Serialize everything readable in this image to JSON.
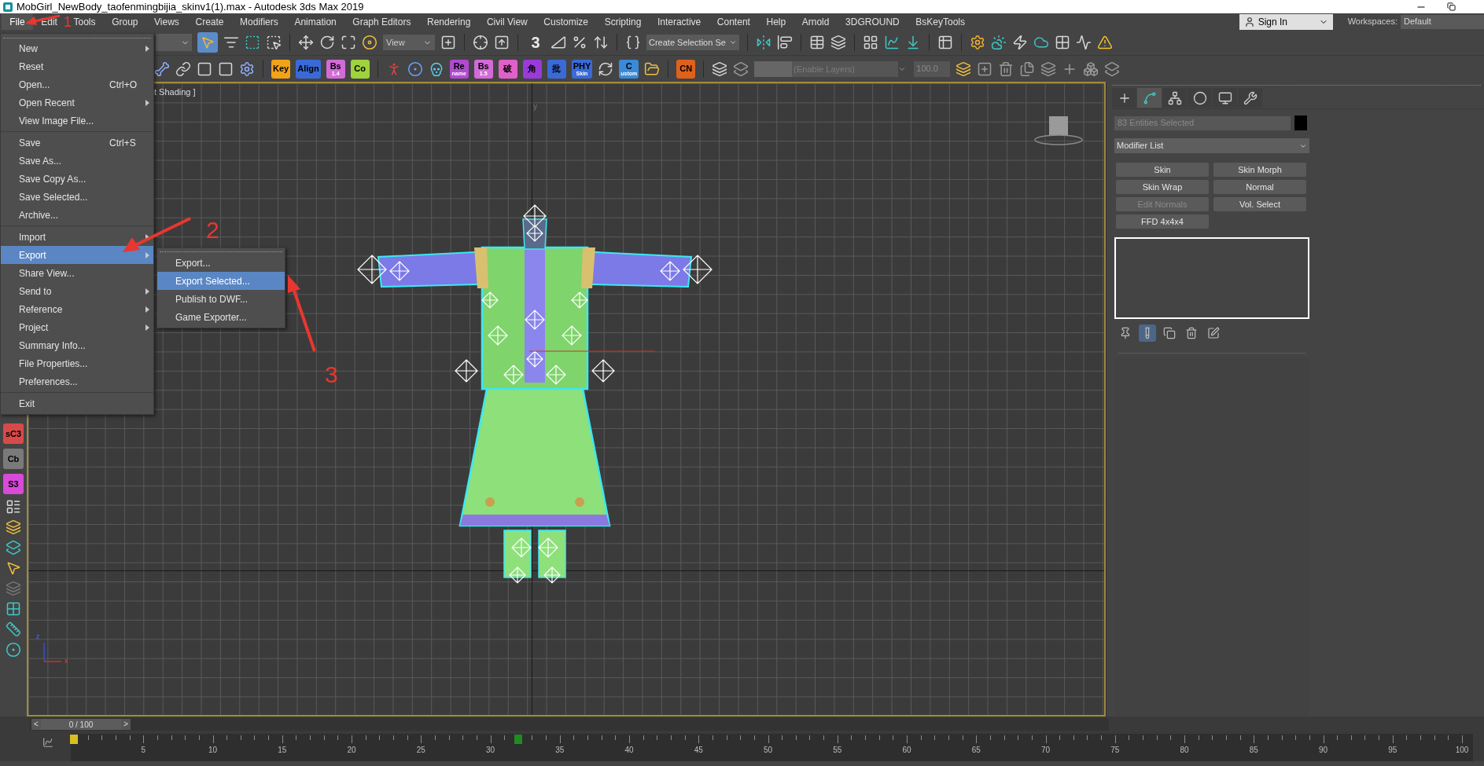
{
  "window": {
    "title": "MobGirl_NewBody_taofenmingbijia_skinv1(1).max - Autodesk 3ds Max 2019"
  },
  "menu_bar": {
    "items": [
      {
        "label": "File",
        "selected": true
      },
      {
        "label": "Edit",
        "selected": false
      },
      {
        "label": "Tools",
        "selected": false
      },
      {
        "label": "Group",
        "selected": false
      },
      {
        "label": "Views",
        "selected": false
      },
      {
        "label": "Create",
        "selected": false
      },
      {
        "label": "Modifiers",
        "selected": false
      },
      {
        "label": "Animation",
        "selected": false
      },
      {
        "label": "Graph Editors",
        "selected": false
      },
      {
        "label": "Rendering",
        "selected": false
      },
      {
        "label": "Civil View",
        "selected": false
      },
      {
        "label": "Customize",
        "selected": false
      },
      {
        "label": "Scripting",
        "selected": false
      },
      {
        "label": "Interactive",
        "selected": false
      },
      {
        "label": "Content",
        "selected": false
      },
      {
        "label": "Help",
        "selected": false
      },
      {
        "label": "Arnold",
        "selected": false
      },
      {
        "label": "3DGROUND",
        "selected": false
      },
      {
        "label": "BsKeyTools",
        "selected": false
      }
    ],
    "sign_in": "Sign In",
    "workspaces_label": "Workspaces:",
    "workspace": "Default"
  },
  "file_menu": {
    "groups": [
      [
        {
          "label": "New",
          "submenu": true,
          "selected": false
        },
        {
          "label": "Reset",
          "submenu": false,
          "selected": false
        },
        {
          "label": "Open...",
          "shortcut": "Ctrl+O",
          "submenu": false,
          "selected": false
        },
        {
          "label": "Open Recent",
          "submenu": true,
          "selected": false
        },
        {
          "label": "View Image File...",
          "submenu": false,
          "selected": false
        }
      ],
      [
        {
          "label": "Save",
          "shortcut": "Ctrl+S",
          "submenu": false,
          "selected": false
        },
        {
          "label": "Save As...",
          "submenu": false,
          "selected": false
        },
        {
          "label": "Save Copy As...",
          "submenu": false,
          "selected": false
        },
        {
          "label": "Save Selected...",
          "submenu": false,
          "selected": false
        },
        {
          "label": "Archive...",
          "submenu": false,
          "selected": false
        }
      ],
      [
        {
          "label": "Import",
          "submenu": true,
          "selected": false
        },
        {
          "label": "Export",
          "submenu": true,
          "selected": true
        },
        {
          "label": "Share View...",
          "submenu": false,
          "selected": false
        },
        {
          "label": "Send to",
          "submenu": true,
          "selected": false
        },
        {
          "label": "Reference",
          "submenu": true,
          "selected": false
        },
        {
          "label": "Project",
          "submenu": true,
          "selected": false
        },
        {
          "label": "Summary Info...",
          "submenu": false,
          "selected": false
        },
        {
          "label": "File Properties...",
          "submenu": false,
          "selected": false
        },
        {
          "label": "Preferences...",
          "submenu": false,
          "selected": false
        }
      ],
      [
        {
          "label": "Exit",
          "submenu": false,
          "selected": false
        }
      ]
    ]
  },
  "export_submenu": {
    "items": [
      {
        "label": "Export...",
        "selected": false
      },
      {
        "label": "Export Selected...",
        "selected": true
      },
      {
        "label": "Publish to DWF...",
        "selected": false
      },
      {
        "label": "Game Exporter...",
        "selected": false
      }
    ]
  },
  "main_toolbar": {
    "view_dropdown": "View",
    "snap_label": "3",
    "named_selection": "Create Selection Se"
  },
  "script_toolbar": {
    "badges_a": [
      {
        "label": "Key",
        "color": "#f2a318"
      },
      {
        "label": "Align",
        "color": "#3a6ad8"
      },
      {
        "label": "Bs",
        "sub": "1.4",
        "color": "#d46ad8"
      },
      {
        "label": "Co",
        "color": "#9fd23c"
      }
    ],
    "badges_b": [
      {
        "label": "Re",
        "sub": "name",
        "color": "#b04ad0"
      },
      {
        "label": "Bs",
        "sub": "1.5",
        "color": "#d46ad8"
      },
      {
        "label": "破",
        "color": "#e060c8"
      },
      {
        "label": "角",
        "color": "#9a3ad8"
      },
      {
        "label": "批",
        "color": "#3a6ad8"
      },
      {
        "label": "PHY",
        "sub": "Skin",
        "color": "#3a6ad8"
      }
    ],
    "badges_c": [
      {
        "label": "C",
        "sub": "ustom",
        "color": "#3a8ad8"
      }
    ],
    "badges_d": [
      {
        "label": "CN",
        "color": "#e0601c"
      }
    ],
    "layer_field": {
      "placeholder": "(Enable Layers)"
    },
    "opacity": "100.0"
  },
  "left_toolbar": {
    "badges": [
      {
        "label": "sC3",
        "color": "#d84a4a"
      },
      {
        "label": "Cb",
        "color": "#7a7a7a"
      },
      {
        "label": "S3",
        "color": "#d84ad8"
      }
    ]
  },
  "viewport": {
    "label": "t Shading ]",
    "grid_axis_label": "y",
    "tripod_labels": [
      "z",
      "x"
    ]
  },
  "command_panel": {
    "tabs": [
      {
        "kind": "create",
        "selected": false
      },
      {
        "kind": "modify",
        "selected": true
      },
      {
        "kind": "hierarchy",
        "selected": false
      },
      {
        "kind": "motion",
        "selected": false
      },
      {
        "kind": "display",
        "selected": false
      },
      {
        "kind": "utilities",
        "selected": false
      }
    ],
    "selection_name": "83 Entities Selected",
    "modifier_list": "Modifier List",
    "modifier_buttons": [
      {
        "label": "Skin",
        "disabled": false
      },
      {
        "label": "Skin Morph",
        "disabled": false
      },
      {
        "label": "Skin Wrap",
        "disabled": false
      },
      {
        "label": "Normal",
        "disabled": false
      },
      {
        "label": "Edit Normals",
        "disabled": true
      },
      {
        "label": "Vol. Select",
        "disabled": false
      },
      {
        "label": "FFD 4x4x4",
        "disabled": false
      }
    ],
    "stack_tools": [
      {
        "kind": "pin",
        "selected": false
      },
      {
        "kind": "show_end",
        "selected": true
      },
      {
        "kind": "make_unique",
        "selected": false
      },
      {
        "kind": "remove",
        "selected": false
      },
      {
        "kind": "configure",
        "selected": false
      }
    ]
  },
  "time_slider": {
    "prev": "<",
    "frame": "0 / 100",
    "next": ">"
  },
  "track_bar": {
    "ticks": [
      "5",
      "10",
      "15",
      "20",
      "25",
      "30",
      "35",
      "40",
      "45",
      "50",
      "55",
      "60",
      "65",
      "70",
      "75",
      "80",
      "85",
      "90",
      "95",
      "100"
    ],
    "keys": [
      {
        "level": 0,
        "color": "#d8c020"
      },
      {
        "level": 0.32,
        "color": "#1e8c1e"
      }
    ]
  },
  "annotations": [
    {
      "label": "1"
    },
    {
      "label": "2"
    },
    {
      "label": "3"
    }
  ]
}
